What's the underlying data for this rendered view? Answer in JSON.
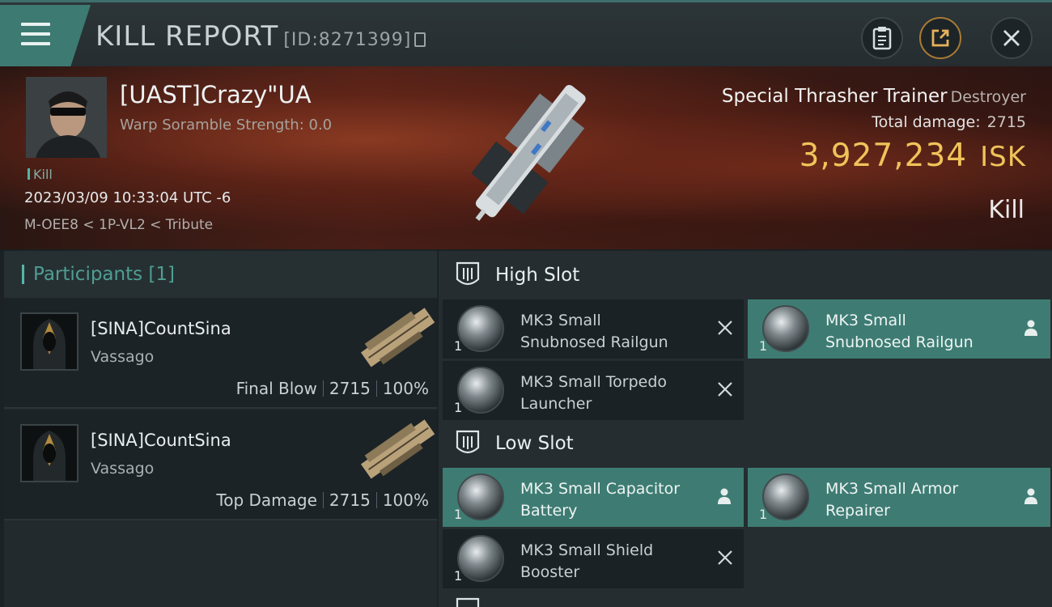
{
  "header": {
    "title": "KILL REPORT",
    "report_id": "[ID:8271399]"
  },
  "victim": {
    "name": "[UAST]Crazy\"UA",
    "subtitle": "Warp Soramble Strength: 0.0",
    "kill_tag": "Kill",
    "datetime": "2023/03/09 10:33:04 UTC -6",
    "location": "M-OEE8 < 1P-VL2 < Tribute",
    "ship_name": "Special Thrasher Trainer",
    "ship_class": "Destroyer",
    "total_damage_label": "Total damage:",
    "total_damage_value": "2715",
    "isk_value": "3,927,234",
    "isk_unit": "ISK",
    "result_label": "Kill"
  },
  "participants": {
    "title": "Participants [1]",
    "items": [
      {
        "name": "[SINA]CountSina",
        "ship": "Vassago",
        "role": "Final Blow",
        "damage": "2715",
        "percent": "100%"
      },
      {
        "name": "[SINA]CountSina",
        "ship": "Vassago",
        "role": "Top Damage",
        "damage": "2715",
        "percent": "100%"
      }
    ]
  },
  "slots": {
    "high": {
      "title": "High Slot",
      "modules": [
        {
          "name_line1": "MK3 Small",
          "name_line2": "Snubnosed Railgun",
          "qty": "1",
          "state": "dropped"
        },
        {
          "name_line1": "MK3 Small",
          "name_line2": "Snubnosed Railgun",
          "qty": "1",
          "state": "fitted"
        },
        {
          "name_line1": "MK3 Small Torpedo",
          "name_line2": "Launcher",
          "qty": "1",
          "state": "dropped"
        }
      ]
    },
    "low": {
      "title": "Low Slot",
      "modules": [
        {
          "name_line1": "MK3 Small Capacitor",
          "name_line2": "Battery",
          "qty": "1",
          "state": "fitted"
        },
        {
          "name_line1": "MK3 Small Armor",
          "name_line2": "Repairer",
          "qty": "1",
          "state": "fitted"
        },
        {
          "name_line1": "MK3 Small Shield",
          "name_line2": "Booster",
          "qty": "1",
          "state": "dropped"
        }
      ]
    }
  },
  "colors": {
    "accent_teal": "#3e7c73",
    "isk_gold": "#f0c35a",
    "header_dark": "#252d30"
  },
  "icons": {
    "menu": "hamburger-icon",
    "clipboard": "clipboard-icon",
    "share": "share-icon",
    "close": "close-icon",
    "copy": "copy-icon",
    "slot": "slot-shield-icon",
    "destroyed": "x-icon",
    "fitted": "person-icon"
  }
}
